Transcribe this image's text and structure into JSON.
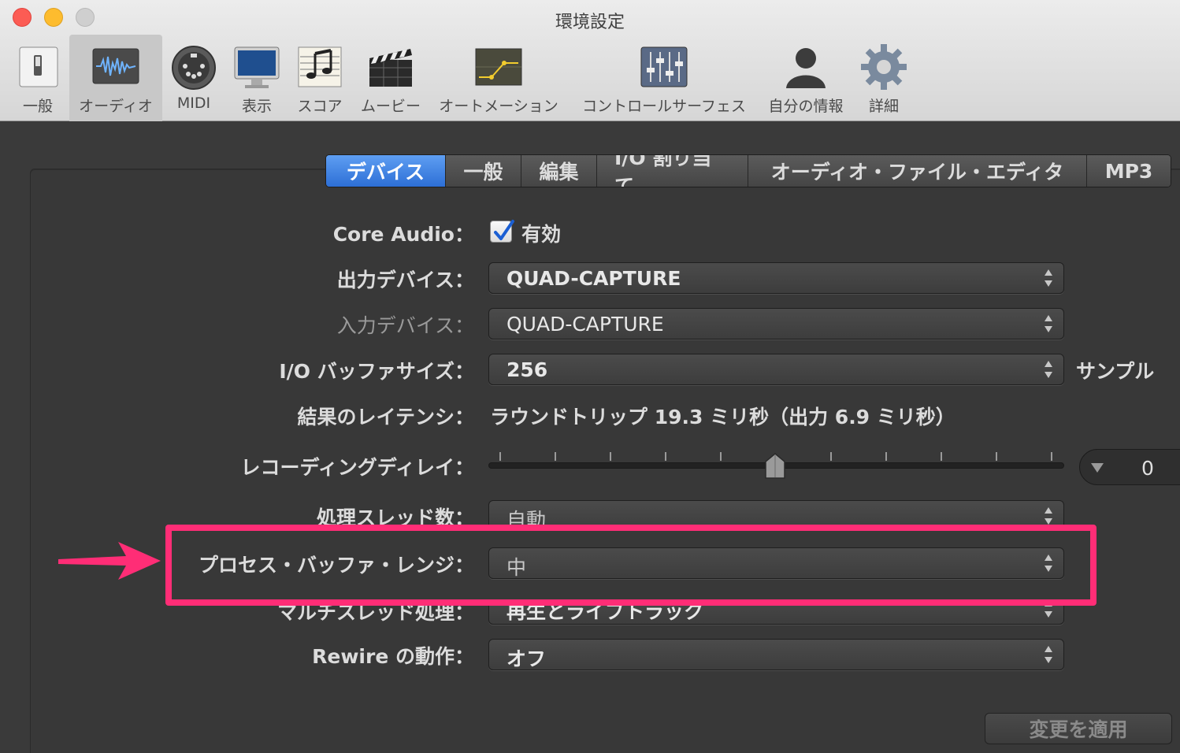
{
  "window": {
    "title": "環境設定"
  },
  "toolbar": {
    "items": [
      {
        "label": "一般",
        "icon": "switch-icon"
      },
      {
        "label": "オーディオ",
        "icon": "waveform-icon"
      },
      {
        "label": "MIDI",
        "icon": "midi-port-icon"
      },
      {
        "label": "表示",
        "icon": "monitor-icon"
      },
      {
        "label": "スコア",
        "icon": "score-icon"
      },
      {
        "label": "ムービー",
        "icon": "clapper-icon"
      },
      {
        "label": "オートメーション",
        "icon": "automation-icon"
      },
      {
        "label": "コントロールサーフェス",
        "icon": "faders-icon"
      },
      {
        "label": "自分の情報",
        "icon": "person-icon"
      },
      {
        "label": "詳細",
        "icon": "gear-icon"
      }
    ],
    "selected": "オーディオ"
  },
  "tabs": {
    "items": [
      "デバイス",
      "一般",
      "編集",
      "I/O 割り当て",
      "オーディオ・ファイル・エディタ",
      "MP3"
    ],
    "active": "デバイス"
  },
  "form": {
    "core_audio": {
      "label": "Core Audio：",
      "checkbox_label": "有効",
      "checked": true
    },
    "output_device": {
      "label": "出力デバイス：",
      "value": "QUAD-CAPTURE"
    },
    "input_device": {
      "label": "入力デバイス：",
      "value": "QUAD-CAPTURE"
    },
    "io_buffer": {
      "label": "I/O バッファサイズ：",
      "value": "256",
      "unit": "サンプル"
    },
    "latency": {
      "label": "結果のレイテンシ：",
      "value": "ラウンドトリップ 19.3 ミリ秒（出力 6.9 ミリ秒）"
    },
    "recording_delay": {
      "label": "レコーディングディレイ：",
      "value": "0",
      "slider_position": 0.5
    },
    "threads": {
      "label": "処理スレッド数：",
      "value": "自動"
    },
    "process_buffer": {
      "label": "プロセス・バッファ・レンジ：",
      "value": "中"
    },
    "multithread": {
      "label": "マルチスレッド処理：",
      "value": "再生とライブトラック"
    },
    "rewire": {
      "label": "Rewire の動作：",
      "value": "オフ"
    }
  },
  "apply_button": {
    "label": "変更を適用"
  },
  "colors": {
    "accent": "#2d6fd6",
    "annotation": "#ff2d76"
  }
}
